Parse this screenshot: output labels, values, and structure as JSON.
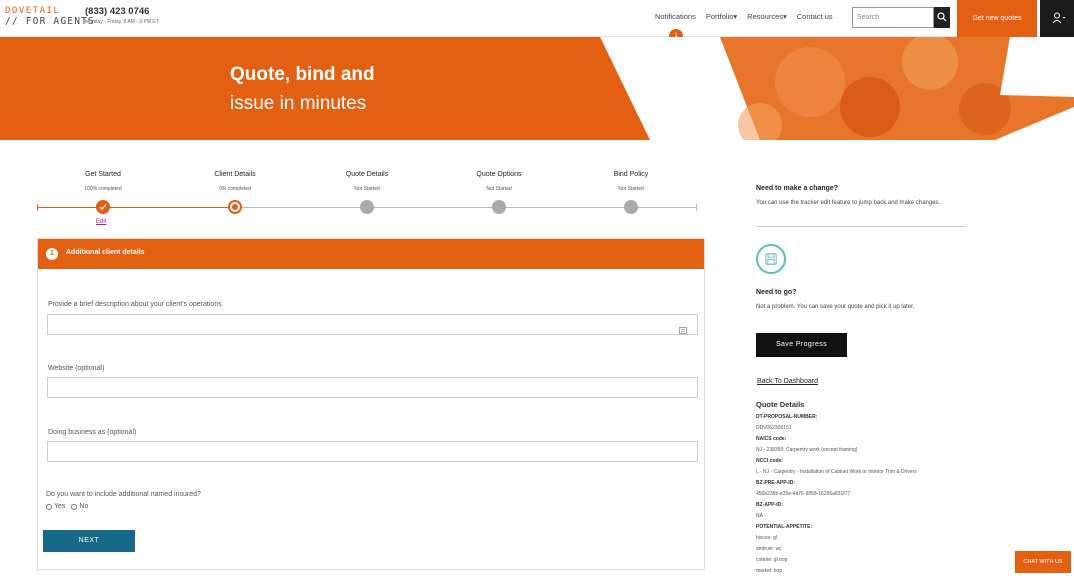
{
  "brand": {
    "line1": "DOVETAIL",
    "line2": "// FOR AGENTS",
    "phone": "(833) 423 0746",
    "hours": "Monday - Friday, 8 AM - 9 PM ET"
  },
  "nav": {
    "notifications": "Notifications",
    "notifications_count": "1",
    "portfolio": "Portfolio▾",
    "resources": "Resources▾",
    "contact": "Contact us",
    "search_placeholder": "Search",
    "cta": "Get new quotes"
  },
  "hero": {
    "line1": "Quote, bind and",
    "line2": "issue in minutes"
  },
  "tracker": {
    "steps": [
      {
        "title": "Get Started",
        "status": "100% completed"
      },
      {
        "title": "Client Details",
        "status": "0% completed"
      },
      {
        "title": "Quote Details",
        "status": "Not Started"
      },
      {
        "title": "Quote Options",
        "status": "Not Started"
      },
      {
        "title": "Bind Policy",
        "status": "Not Started"
      }
    ],
    "edit_label": "Edit"
  },
  "form": {
    "step_number": "1",
    "title": "Additional client details",
    "description_label": "Provide a brief description about your client's operations",
    "website_label": "Website (optional)",
    "dba_label": "Doing business as (optional)",
    "named_insured_question": "Do you want to include additional named insured?",
    "yes": "Yes",
    "no": "No",
    "next": "NEXT"
  },
  "sidebar": {
    "change_title": "Need to make a change?",
    "change_text": "You can use the tracker edit feature to jump back and make changes.",
    "go_title": "Need to go?",
    "go_text": "Not a problem. You can save your quote and pick it up later.",
    "save": "Save Progress",
    "dashboard": "Back To Dashboard",
    "quote_details_title": "Quote Details",
    "quote_details": [
      {
        "k": "DT-PROPOSAL-NUMBER:",
        "v": "DDV062300151"
      },
      {
        "k": "NAICS code:",
        "v": "NJ - 238350: Carpentry work (except framing)"
      },
      {
        "k": "NCCI code:",
        "v": "L - NJ - Carpentry - Installation of Cabinet Work or Interior Trim & Drivers"
      },
      {
        "k": "BZ-PRE-APP-ID:",
        "v": "456b236b-e25e-4d76-9858-16256a831f77"
      },
      {
        "k": "BZ-APP-ID:",
        "v": "NA"
      },
      {
        "k": "POTENTIAL-APPETITE:",
        "v": "hiscox: gl"
      }
    ],
    "appetite_more": [
      "amtrust: wc",
      "coterie: gl bop",
      "markel: bop"
    ]
  },
  "chat": "CHAT WITH US",
  "colors": {
    "brand_orange": "#e35f12",
    "teal_button": "#166a88",
    "save_icon": "#5dbfb5"
  }
}
